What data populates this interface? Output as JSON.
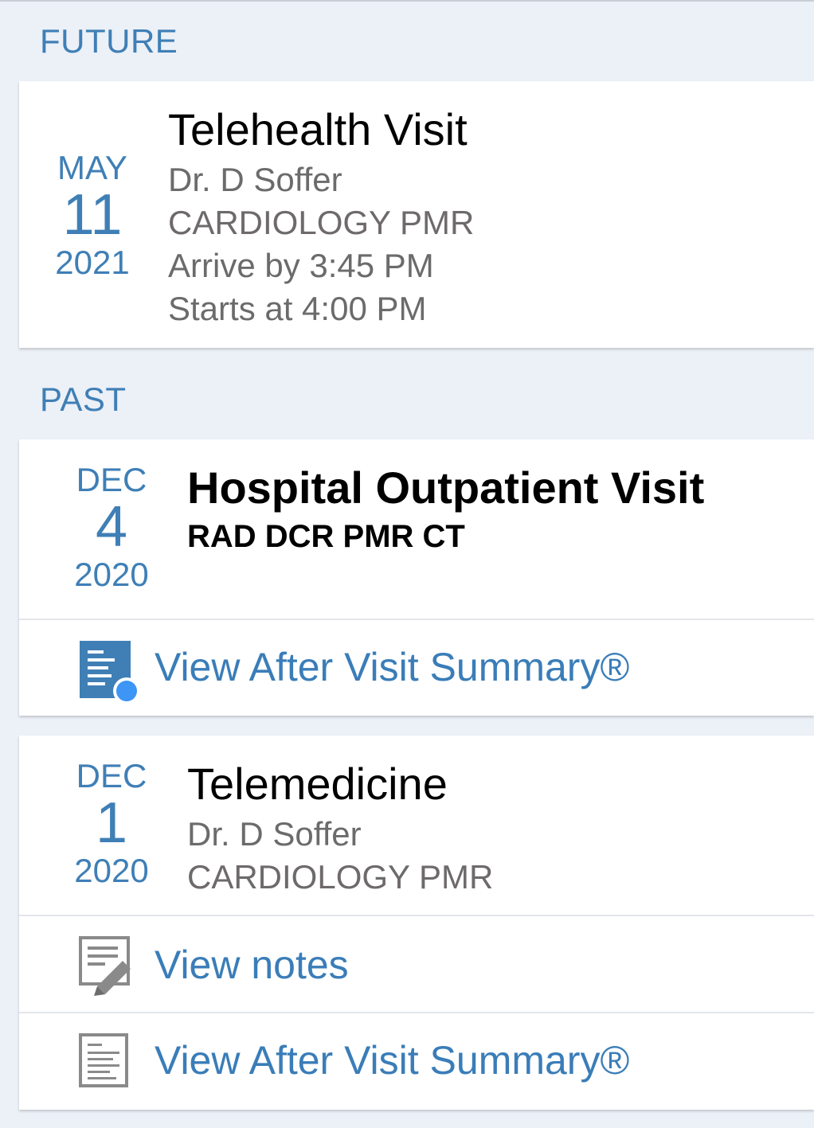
{
  "sections": {
    "future": {
      "label": "FUTURE"
    },
    "past": {
      "label": "PAST"
    }
  },
  "future_visit": {
    "month": "MAY",
    "day": "11",
    "year": "2021",
    "title": "Telehealth Visit",
    "provider": "Dr. D Soffer",
    "department": "CARDIOLOGY PMR",
    "arrive": "Arrive by 3:45 PM",
    "starts": "Starts at 4:00 PM"
  },
  "past_visits": [
    {
      "month": "DEC",
      "day": "4",
      "year": "2020",
      "title": "Hospital Outpatient Visit",
      "department": "RAD DCR PMR CT",
      "actions": [
        {
          "label": "View After Visit Summary®",
          "icon": "after-visit-summary-new-icon"
        }
      ]
    },
    {
      "month": "DEC",
      "day": "1",
      "year": "2020",
      "title": "Telemedicine",
      "provider": "Dr. D Soffer",
      "department": "CARDIOLOGY PMR",
      "actions": [
        {
          "label": "View notes",
          "icon": "notes-icon"
        },
        {
          "label": "View After Visit Summary®",
          "icon": "after-visit-summary-icon"
        }
      ]
    }
  ],
  "colors": {
    "accent": "#3f7fb6",
    "link": "#3a7db8",
    "background": "#ecf0f7",
    "badge": "#3d95f5"
  }
}
